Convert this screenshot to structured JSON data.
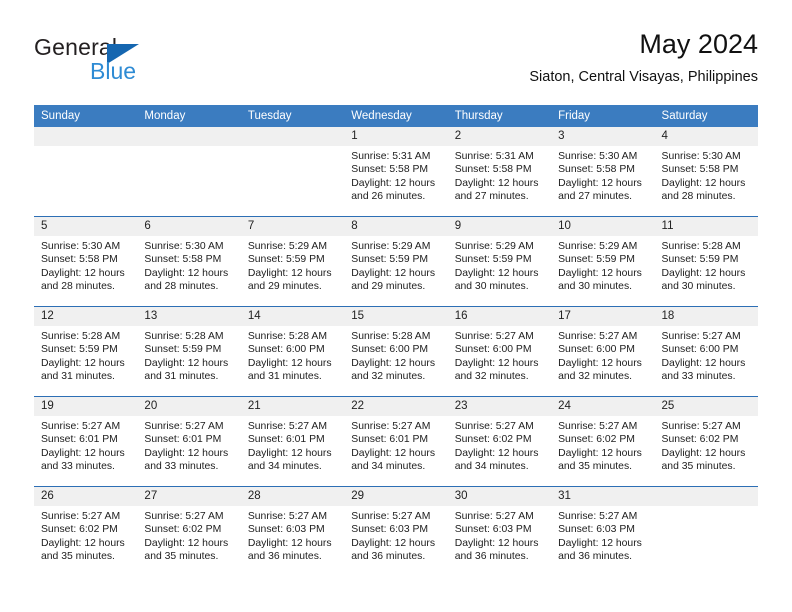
{
  "brand": {
    "name_part1": "General",
    "name_part2": "Blue"
  },
  "header": {
    "title": "May 2024",
    "subtitle": "Siaton, Central Visayas, Philippines"
  },
  "calendar": {
    "weekday_headers": [
      "Sunday",
      "Monday",
      "Tuesday",
      "Wednesday",
      "Thursday",
      "Friday",
      "Saturday"
    ],
    "colors": {
      "header_background": "#3b7cc0",
      "header_text": "#ffffff",
      "daynum_background": "#f0f0f0",
      "row_separator": "#2d6fb5",
      "brand_blue": "#2e8bd4",
      "logo_triangle": "#1566b0"
    },
    "weeks": [
      [
        {
          "day": "",
          "sunrise": "",
          "sunset": "",
          "daylight": ""
        },
        {
          "day": "",
          "sunrise": "",
          "sunset": "",
          "daylight": ""
        },
        {
          "day": "",
          "sunrise": "",
          "sunset": "",
          "daylight": ""
        },
        {
          "day": "1",
          "sunrise": "Sunrise: 5:31 AM",
          "sunset": "Sunset: 5:58 PM",
          "daylight": "Daylight: 12 hours and 26 minutes."
        },
        {
          "day": "2",
          "sunrise": "Sunrise: 5:31 AM",
          "sunset": "Sunset: 5:58 PM",
          "daylight": "Daylight: 12 hours and 27 minutes."
        },
        {
          "day": "3",
          "sunrise": "Sunrise: 5:30 AM",
          "sunset": "Sunset: 5:58 PM",
          "daylight": "Daylight: 12 hours and 27 minutes."
        },
        {
          "day": "4",
          "sunrise": "Sunrise: 5:30 AM",
          "sunset": "Sunset: 5:58 PM",
          "daylight": "Daylight: 12 hours and 28 minutes."
        }
      ],
      [
        {
          "day": "5",
          "sunrise": "Sunrise: 5:30 AM",
          "sunset": "Sunset: 5:58 PM",
          "daylight": "Daylight: 12 hours and 28 minutes."
        },
        {
          "day": "6",
          "sunrise": "Sunrise: 5:30 AM",
          "sunset": "Sunset: 5:58 PM",
          "daylight": "Daylight: 12 hours and 28 minutes."
        },
        {
          "day": "7",
          "sunrise": "Sunrise: 5:29 AM",
          "sunset": "Sunset: 5:59 PM",
          "daylight": "Daylight: 12 hours and 29 minutes."
        },
        {
          "day": "8",
          "sunrise": "Sunrise: 5:29 AM",
          "sunset": "Sunset: 5:59 PM",
          "daylight": "Daylight: 12 hours and 29 minutes."
        },
        {
          "day": "9",
          "sunrise": "Sunrise: 5:29 AM",
          "sunset": "Sunset: 5:59 PM",
          "daylight": "Daylight: 12 hours and 30 minutes."
        },
        {
          "day": "10",
          "sunrise": "Sunrise: 5:29 AM",
          "sunset": "Sunset: 5:59 PM",
          "daylight": "Daylight: 12 hours and 30 minutes."
        },
        {
          "day": "11",
          "sunrise": "Sunrise: 5:28 AM",
          "sunset": "Sunset: 5:59 PM",
          "daylight": "Daylight: 12 hours and 30 minutes."
        }
      ],
      [
        {
          "day": "12",
          "sunrise": "Sunrise: 5:28 AM",
          "sunset": "Sunset: 5:59 PM",
          "daylight": "Daylight: 12 hours and 31 minutes."
        },
        {
          "day": "13",
          "sunrise": "Sunrise: 5:28 AM",
          "sunset": "Sunset: 5:59 PM",
          "daylight": "Daylight: 12 hours and 31 minutes."
        },
        {
          "day": "14",
          "sunrise": "Sunrise: 5:28 AM",
          "sunset": "Sunset: 6:00 PM",
          "daylight": "Daylight: 12 hours and 31 minutes."
        },
        {
          "day": "15",
          "sunrise": "Sunrise: 5:28 AM",
          "sunset": "Sunset: 6:00 PM",
          "daylight": "Daylight: 12 hours and 32 minutes."
        },
        {
          "day": "16",
          "sunrise": "Sunrise: 5:27 AM",
          "sunset": "Sunset: 6:00 PM",
          "daylight": "Daylight: 12 hours and 32 minutes."
        },
        {
          "day": "17",
          "sunrise": "Sunrise: 5:27 AM",
          "sunset": "Sunset: 6:00 PM",
          "daylight": "Daylight: 12 hours and 32 minutes."
        },
        {
          "day": "18",
          "sunrise": "Sunrise: 5:27 AM",
          "sunset": "Sunset: 6:00 PM",
          "daylight": "Daylight: 12 hours and 33 minutes."
        }
      ],
      [
        {
          "day": "19",
          "sunrise": "Sunrise: 5:27 AM",
          "sunset": "Sunset: 6:01 PM",
          "daylight": "Daylight: 12 hours and 33 minutes."
        },
        {
          "day": "20",
          "sunrise": "Sunrise: 5:27 AM",
          "sunset": "Sunset: 6:01 PM",
          "daylight": "Daylight: 12 hours and 33 minutes."
        },
        {
          "day": "21",
          "sunrise": "Sunrise: 5:27 AM",
          "sunset": "Sunset: 6:01 PM",
          "daylight": "Daylight: 12 hours and 34 minutes."
        },
        {
          "day": "22",
          "sunrise": "Sunrise: 5:27 AM",
          "sunset": "Sunset: 6:01 PM",
          "daylight": "Daylight: 12 hours and 34 minutes."
        },
        {
          "day": "23",
          "sunrise": "Sunrise: 5:27 AM",
          "sunset": "Sunset: 6:02 PM",
          "daylight": "Daylight: 12 hours and 34 minutes."
        },
        {
          "day": "24",
          "sunrise": "Sunrise: 5:27 AM",
          "sunset": "Sunset: 6:02 PM",
          "daylight": "Daylight: 12 hours and 35 minutes."
        },
        {
          "day": "25",
          "sunrise": "Sunrise: 5:27 AM",
          "sunset": "Sunset: 6:02 PM",
          "daylight": "Daylight: 12 hours and 35 minutes."
        }
      ],
      [
        {
          "day": "26",
          "sunrise": "Sunrise: 5:27 AM",
          "sunset": "Sunset: 6:02 PM",
          "daylight": "Daylight: 12 hours and 35 minutes."
        },
        {
          "day": "27",
          "sunrise": "Sunrise: 5:27 AM",
          "sunset": "Sunset: 6:02 PM",
          "daylight": "Daylight: 12 hours and 35 minutes."
        },
        {
          "day": "28",
          "sunrise": "Sunrise: 5:27 AM",
          "sunset": "Sunset: 6:03 PM",
          "daylight": "Daylight: 12 hours and 36 minutes."
        },
        {
          "day": "29",
          "sunrise": "Sunrise: 5:27 AM",
          "sunset": "Sunset: 6:03 PM",
          "daylight": "Daylight: 12 hours and 36 minutes."
        },
        {
          "day": "30",
          "sunrise": "Sunrise: 5:27 AM",
          "sunset": "Sunset: 6:03 PM",
          "daylight": "Daylight: 12 hours and 36 minutes."
        },
        {
          "day": "31",
          "sunrise": "Sunrise: 5:27 AM",
          "sunset": "Sunset: 6:03 PM",
          "daylight": "Daylight: 12 hours and 36 minutes."
        },
        {
          "day": "",
          "sunrise": "",
          "sunset": "",
          "daylight": ""
        }
      ]
    ]
  }
}
